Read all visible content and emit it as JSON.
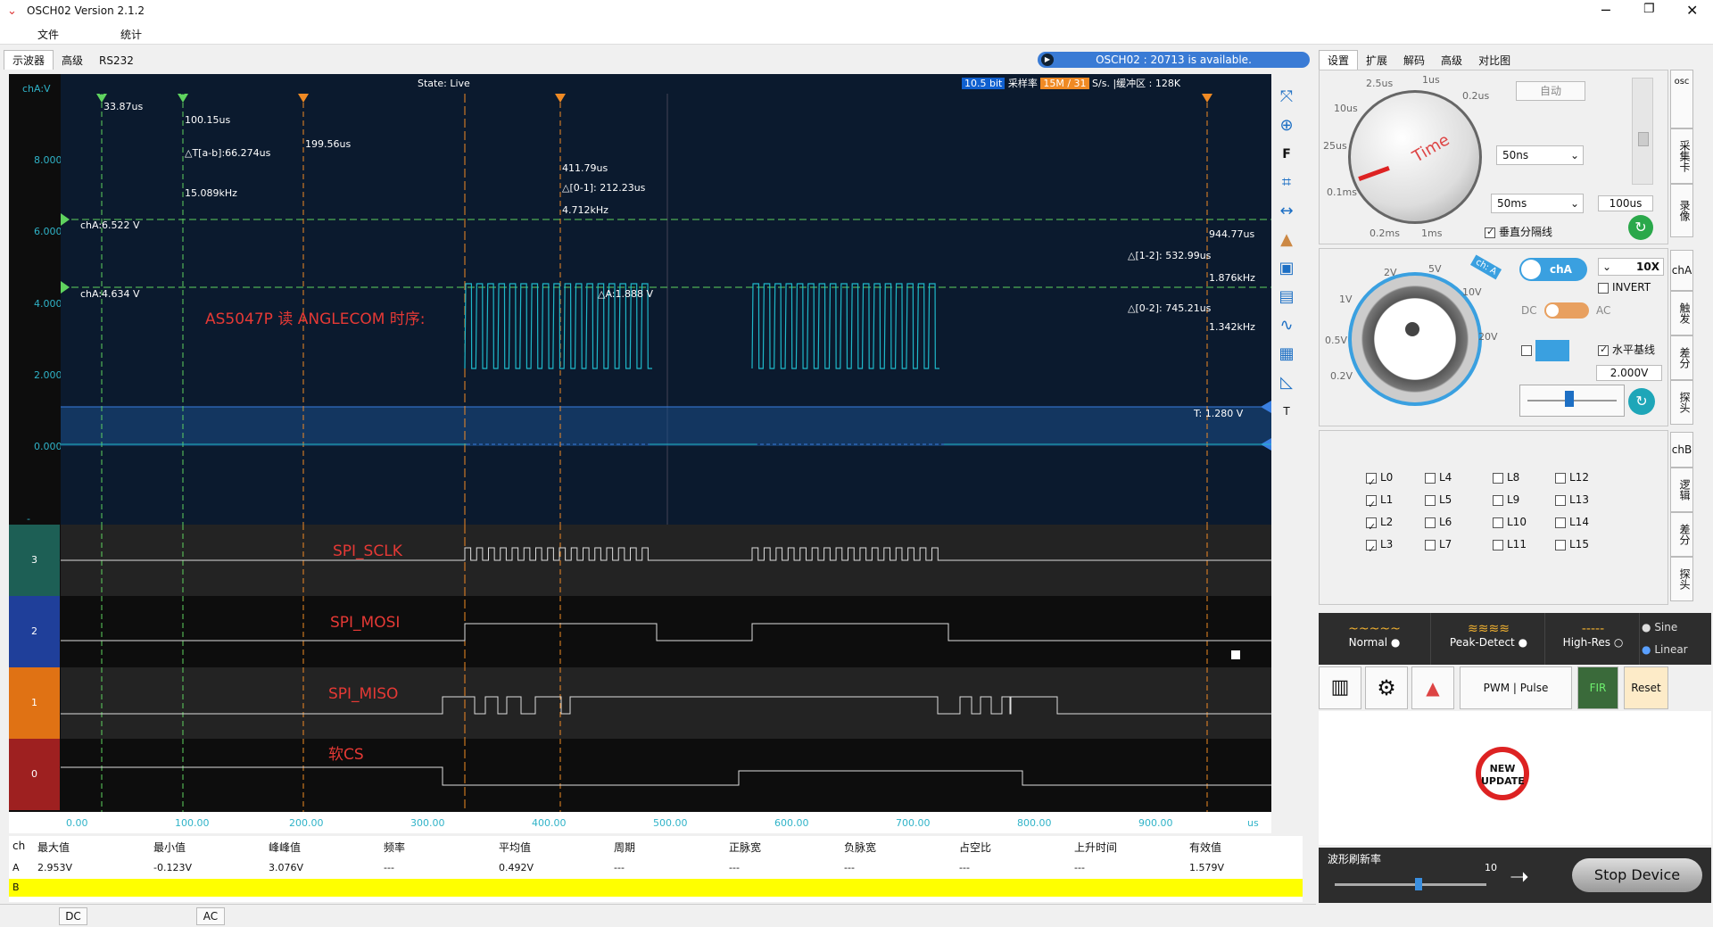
{
  "app": {
    "title": "OSCH02  Version 2.1.2",
    "menu": [
      "文件",
      "统计"
    ]
  },
  "left_tabs": [
    "示波器",
    "高级",
    "RS232"
  ],
  "notice": "OSCH02 : 20713 is available.",
  "scope": {
    "state": "State: Live",
    "bits": "10.5 bit",
    "rate_label": "采样率",
    "rate_value": "15M / 31",
    "rate_unit": "S/s. |缓冲区 : 128K",
    "channel_label": "chA:V",
    "y_ticks": [
      "8.000",
      "6.000",
      "4.000",
      "2.000",
      "0.000",
      "- 2.000"
    ],
    "x_ticks": [
      "0.00",
      "100.00",
      "200.00",
      "300.00",
      "400.00",
      "500.00",
      "600.00",
      "700.00",
      "800.00",
      "900.00"
    ],
    "x_unit": "us",
    "title_text": "AS5047P 读 ANGLECOM 时序:",
    "annotations": {
      "a_time": "33.87us",
      "b_time": "100.15us",
      "dt_ab": "△T[a-b]:66.274us",
      "f_ab": "15.089kHz",
      "c0_time": "199.56us",
      "c1_time": "411.79us",
      "dt01": "△[0-1]: 212.23us",
      "f01": "4.712kHz",
      "c2_time": "944.77us",
      "dt12": "△[1-2]: 532.99us",
      "f12": "1.876kHz",
      "dt02": "△[0-2]: 745.21us",
      "f02": "1.342kHz",
      "chA1": "chA:6.522 V",
      "chA2": "chA:4.634 V",
      "dA": "△A:1.888 V",
      "trigger": "T: 1.280 V"
    },
    "cursor_labels": [
      "a",
      "b",
      "0",
      "1",
      "2"
    ]
  },
  "logic": {
    "rows": [
      {
        "num": "3",
        "name": "SPI_SCLK"
      },
      {
        "num": "2",
        "name": "SPI_MOSI"
      },
      {
        "num": "1",
        "name": "SPI_MISO"
      },
      {
        "num": "0",
        "name": "软CS"
      }
    ]
  },
  "toolbar_icons": [
    "fit-icon",
    "zoom-icon",
    "F",
    "cursor-icon",
    "measure-icon",
    "color-icon",
    "save-icon",
    "image-icon",
    "wave-icon",
    "grid-icon",
    "ruler-icon",
    "T"
  ],
  "measurements": {
    "headers": [
      "ch",
      "最大值",
      "最小值",
      "峰峰值",
      "频率",
      "平均值",
      "周期",
      "正脉宽",
      "负脉宽",
      "占空比",
      "上升时间",
      "有效值"
    ],
    "rowA": [
      "A",
      "2.953V",
      "-0.123V",
      "3.076V",
      "---",
      "0.492V",
      "---",
      "---",
      "---",
      "---",
      "---",
      "1.579V"
    ],
    "rowB": "B"
  },
  "bottom": {
    "dc": "DC",
    "ac": "AC"
  },
  "right": {
    "tabs": [
      "设置",
      "扩展",
      "解码",
      "高级",
      "对比图"
    ],
    "time_knob": {
      "labels": [
        "2.5us",
        "1us",
        "0.2us",
        "10us",
        "25us",
        "0.1ms",
        "0.2ms",
        "1ms"
      ],
      "word": "Time"
    },
    "auto": "自动",
    "sel1": "50ns",
    "sel2": "50ms",
    "time_val": "100us",
    "vgrid": "垂直分隔线",
    "side_tabs_top": [
      "osc",
      "采集卡",
      "录像"
    ],
    "volt_knob": {
      "labels": [
        "2V",
        "5V",
        "10V",
        "20V",
        "1V",
        "0.5V",
        "0.2V"
      ],
      "badge": "ch: A"
    },
    "cha_btn": "chA",
    "probe": "10X",
    "invert": "INVERT",
    "dc": "DC",
    "ac": "AC",
    "hline": "水平基线",
    "volt_val": "2.000V",
    "side_tabs_mid": [
      "chA",
      "触发",
      "差分",
      "探头"
    ],
    "logic_lines": [
      [
        "L0",
        "L4",
        "L8",
        "L12"
      ],
      [
        "L1",
        "L5",
        "L9",
        "L13"
      ],
      [
        "L2",
        "L6",
        "L10",
        "L14"
      ],
      [
        "L3",
        "L7",
        "L11",
        "L15"
      ]
    ],
    "logic_checked": [
      "L0",
      "L1",
      "L2",
      "L3"
    ],
    "side_tabs_low": [
      "chB",
      "逻辑",
      "差分",
      "探头"
    ],
    "modes": [
      "Normal",
      "Peak-Detect",
      "High-Res"
    ],
    "interp": [
      "Sine",
      "Linear"
    ],
    "pwm": "PWM | Pulse",
    "fir": "FIR",
    "reset": "Reset",
    "new_update": "NEW UPDATE",
    "refresh_label": "波形刷新率",
    "refresh_val": "10",
    "stop": "Stop Device"
  },
  "colors": {
    "accent": "#1d6fc4",
    "cursor_green": "#5fd35f",
    "cursor_orange": "#f08a24",
    "trace": "#1fb8c9"
  }
}
